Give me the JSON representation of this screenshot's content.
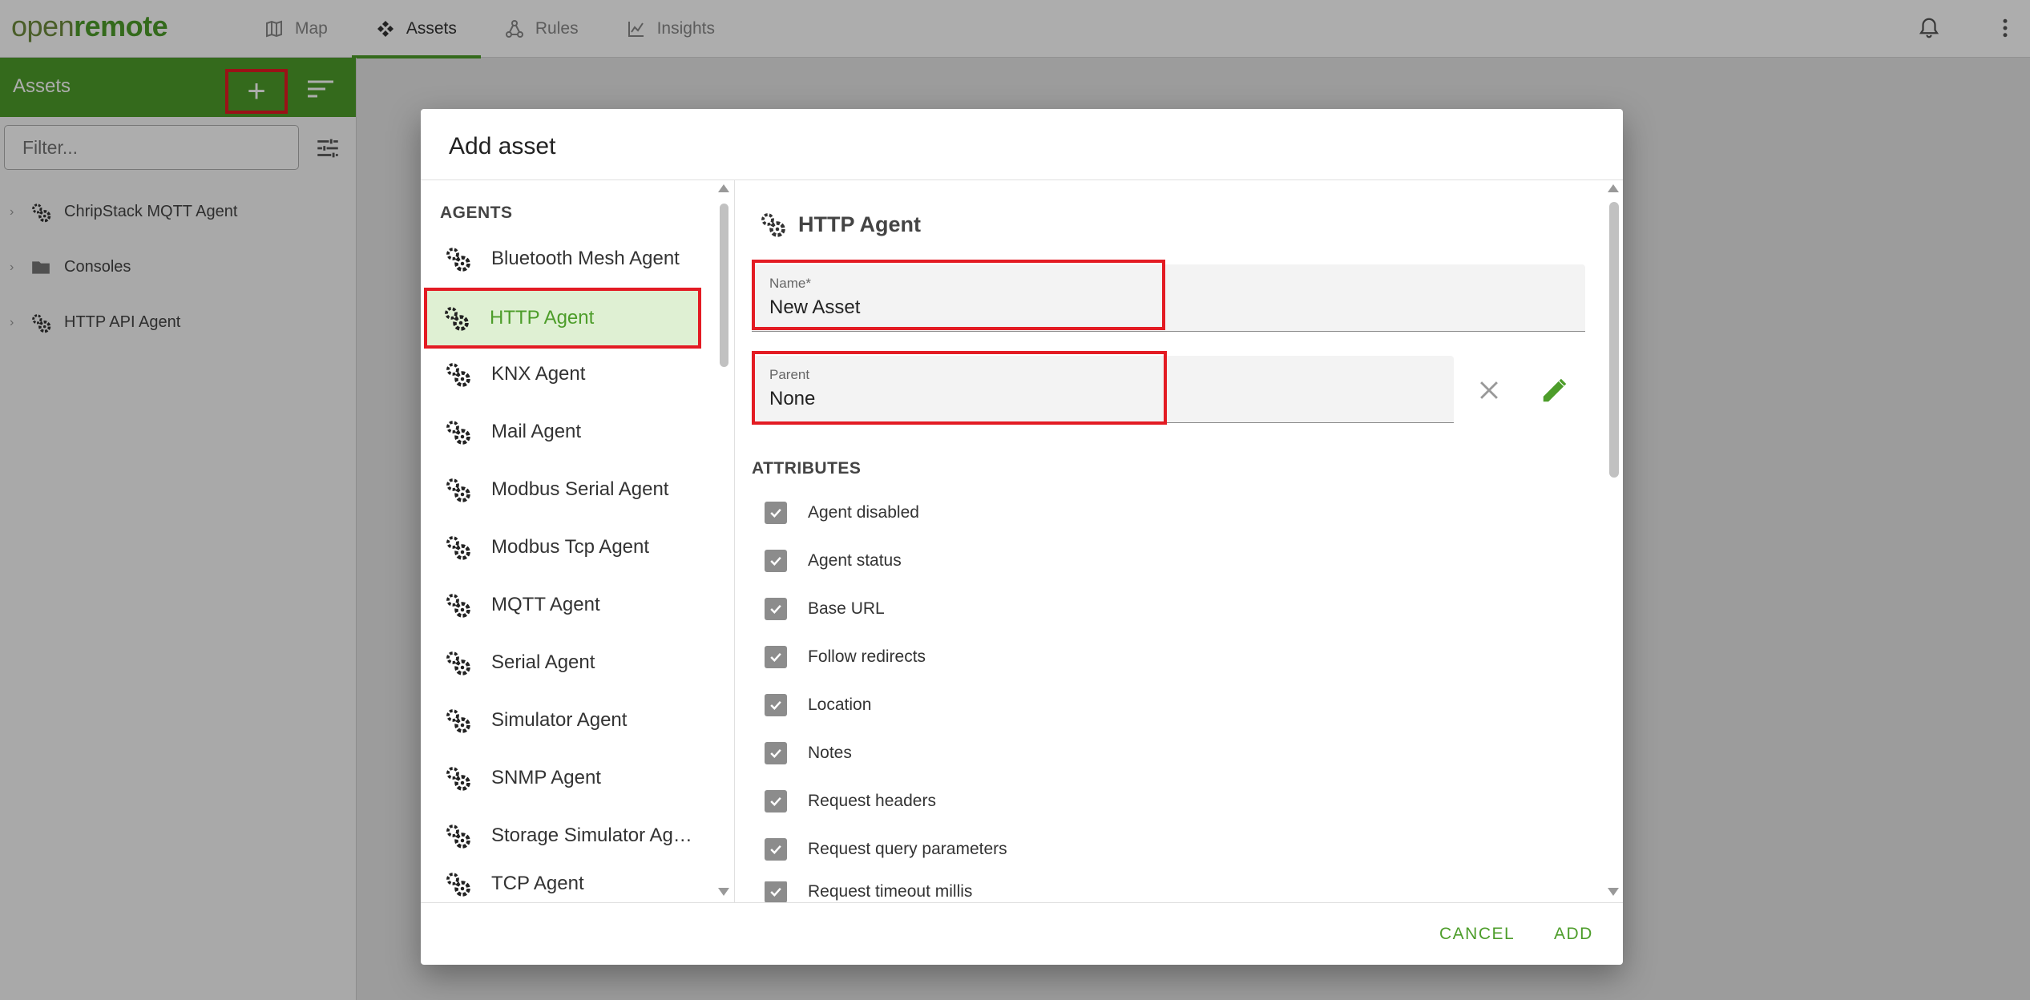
{
  "topbar": {
    "logo_part1": "open",
    "logo_part2": "remote",
    "tabs": [
      {
        "label": "Map",
        "icon": "map-icon",
        "active": false
      },
      {
        "label": "Assets",
        "icon": "assets-icon",
        "active": true
      },
      {
        "label": "Rules",
        "icon": "rules-icon",
        "active": false
      },
      {
        "label": "Insights",
        "icon": "insights-icon",
        "active": false
      }
    ]
  },
  "sidebar": {
    "title": "Assets",
    "filter_placeholder": "Filter...",
    "tree": [
      {
        "label": "ChripStack MQTT Agent",
        "icon": "agent-gears-icon"
      },
      {
        "label": "Consoles",
        "icon": "folder-icon"
      },
      {
        "label": "HTTP API Agent",
        "icon": "agent-gears-icon"
      }
    ]
  },
  "dialog": {
    "title": "Add asset",
    "section_label": "AGENTS",
    "asset_types": [
      {
        "label": "Bluetooth Mesh Agent",
        "selected": false
      },
      {
        "label": "HTTP Agent",
        "selected": true
      },
      {
        "label": "KNX Agent",
        "selected": false
      },
      {
        "label": "Mail Agent",
        "selected": false
      },
      {
        "label": "Modbus Serial Agent",
        "selected": false
      },
      {
        "label": "Modbus Tcp Agent",
        "selected": false
      },
      {
        "label": "MQTT Agent",
        "selected": false
      },
      {
        "label": "Serial Agent",
        "selected": false
      },
      {
        "label": "Simulator Agent",
        "selected": false
      },
      {
        "label": "SNMP Agent",
        "selected": false
      },
      {
        "label": "Storage Simulator Ag…",
        "selected": false
      },
      {
        "label": "TCP Agent",
        "selected": false
      }
    ],
    "selected_heading": "HTTP Agent",
    "name_field": {
      "label": "Name*",
      "value": "New Asset"
    },
    "parent_field": {
      "label": "Parent",
      "value": "None"
    },
    "attributes_label": "ATTRIBUTES",
    "attributes": [
      {
        "label": "Agent disabled",
        "checked": true
      },
      {
        "label": "Agent status",
        "checked": true
      },
      {
        "label": "Base URL",
        "checked": true
      },
      {
        "label": "Follow redirects",
        "checked": true
      },
      {
        "label": "Location",
        "checked": true
      },
      {
        "label": "Notes",
        "checked": true
      },
      {
        "label": "Request headers",
        "checked": true
      },
      {
        "label": "Request query parameters",
        "checked": true
      },
      {
        "label": "Request timeout millis",
        "checked": true
      }
    ],
    "cancel_label": "CANCEL",
    "add_label": "ADD"
  },
  "colors": {
    "brand_green": "#4d9d2a",
    "highlight_red": "#e31b23",
    "selected_bg": "#dff0d3"
  }
}
